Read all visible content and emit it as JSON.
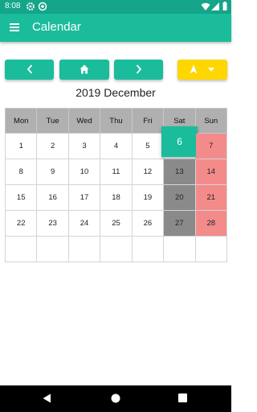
{
  "status_bar": {
    "time": "8:08"
  },
  "app_bar": {
    "title": "Calendar"
  },
  "month_title": "2019 December",
  "weekdays": [
    "Mon",
    "Tue",
    "Wed",
    "Thu",
    "Fri",
    "Sat",
    "Sun"
  ],
  "weeks": [
    [
      "1",
      "2",
      "3",
      "4",
      "5",
      "6",
      "7"
    ],
    [
      "8",
      "9",
      "10",
      "11",
      "12",
      "13",
      "14"
    ],
    [
      "15",
      "16",
      "17",
      "18",
      "19",
      "20",
      "21"
    ],
    [
      "22",
      "23",
      "24",
      "25",
      "26",
      "27",
      "28"
    ],
    [
      "",
      "",
      "",
      "",
      "",
      "",
      ""
    ]
  ],
  "selected_day": "6",
  "colors": {
    "accent": "#1abc9c",
    "status_bar": "#14a58a",
    "saturday": "#8a8a8a",
    "sunday": "#f48b8b",
    "header_row": "#b0b0b0",
    "navigate_button": "#ffd600"
  },
  "icons": {
    "status": [
      "gear-icon",
      "sync-icon",
      "wifi-icon",
      "signal-icon",
      "battery-icon"
    ],
    "toolbar": [
      "chevron-left-icon",
      "home-icon",
      "chevron-right-icon",
      "navigation-arrow-icon",
      "dropdown-caret-icon"
    ],
    "system_nav": [
      "back-icon",
      "home-circle-icon",
      "recents-icon"
    ]
  }
}
